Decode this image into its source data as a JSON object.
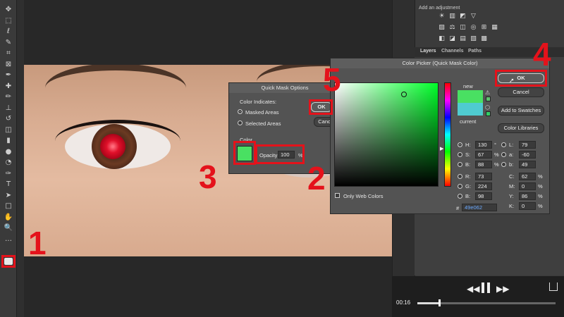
{
  "toolbar": {
    "tools": [
      "move-icon",
      "marquee-icon",
      "lasso-icon",
      "quick-select-icon",
      "crop-icon",
      "frame-icon",
      "eyedropper-icon",
      "healing-icon",
      "brush-icon",
      "stamp-icon",
      "history-brush-icon",
      "eraser-icon",
      "gradient-icon",
      "blur-icon",
      "dodge-icon",
      "pen-icon",
      "type-icon",
      "path-select-icon",
      "rectangle-icon",
      "hand-icon",
      "zoom-icon",
      "more-icon"
    ],
    "glyphs": [
      "✥",
      "⬚",
      "ℓ",
      "✎",
      "⌗",
      "⊠",
      "✒",
      "✚",
      "✏",
      "⊥",
      "↺",
      "◫",
      "▮",
      "●",
      "◔",
      "✑",
      "T",
      "➤",
      "□",
      "✋",
      "🔍",
      "…"
    ]
  },
  "adjustments": {
    "title": "Add an adjustment",
    "row1": [
      "☀",
      "▥",
      "◩",
      "▽"
    ],
    "row2": [
      "▨",
      "⚖",
      "◫",
      "◎",
      "⊞",
      "▦"
    ],
    "row3": [
      "◧",
      "◪",
      "▤",
      "▧",
      "▩"
    ]
  },
  "panel_tabs": {
    "layers": "Layers",
    "channels": "Channels",
    "paths": "Paths"
  },
  "player": {
    "time": "00:16",
    "progress": 0.16
  },
  "quick_mask": {
    "title": "Quick Mask Options",
    "group_label": "Color Indicates:",
    "option1": "Masked Areas",
    "option2": "Selected Areas",
    "color_label": "Color",
    "opacity_label": "Opacity:",
    "opacity_value": "100",
    "opacity_unit": "%",
    "ok": "OK",
    "cancel": "Canc",
    "swatch": "#49e062"
  },
  "color_picker": {
    "title": "Color Picker (Quick Mask Color)",
    "ok": "OK",
    "cancel": "Cancel",
    "add_swatches": "Add to Swatches",
    "color_libraries": "Color Libraries",
    "new_label": "new",
    "current_label": "current",
    "new_color": "#49e062",
    "current_color": "#4fcbd0",
    "only_web": "Only Web Colors",
    "hex_prefix": "#",
    "hex": "49e062",
    "h_label": "H:",
    "h": "130",
    "h_unit": "°",
    "s_label": "S:",
    "s": "67",
    "s_unit": "%",
    "b_label": "B:",
    "b": "88",
    "b_unit": "%",
    "r_label": "R:",
    "r": "73",
    "g_label": "G:",
    "g": "224",
    "bb_label": "B:",
    "bb": "98",
    "l_label": "L:",
    "l": "79",
    "a_label": "a:",
    "a": "-60",
    "lb_label": "b:",
    "lb": "49",
    "c_label": "C:",
    "c": "62",
    "c_unit": "%",
    "m_label": "M:",
    "m": "0",
    "m_unit": "%",
    "y_label": "Y:",
    "y": "86",
    "y_unit": "%",
    "k_label": "K:",
    "k": "0",
    "k_unit": "%"
  },
  "annotations": {
    "n1": "1",
    "n2": "2",
    "n3": "3",
    "n4": "4",
    "n5": "5",
    "color": "#e4121b"
  }
}
